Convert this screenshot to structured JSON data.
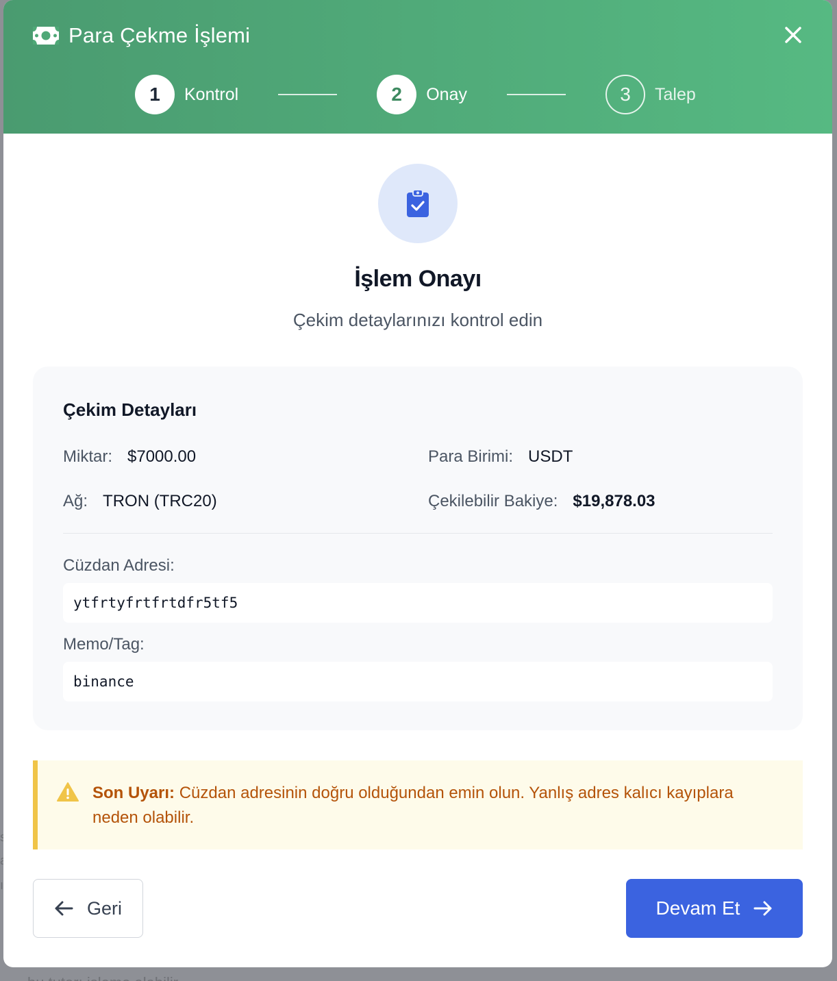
{
  "backdrop": {
    "fragment_bottom": "bu tutarı işleme alabilir..."
  },
  "header": {
    "title": "Para Çekme İşlemi",
    "icons": {
      "title": "money-bill-icon",
      "close": "close-icon"
    },
    "steps": [
      {
        "number": "1",
        "label": "Kontrol",
        "state": "done"
      },
      {
        "number": "2",
        "label": "Onay",
        "state": "active"
      },
      {
        "number": "3",
        "label": "Talep",
        "state": "pending"
      }
    ]
  },
  "hero": {
    "icon": "clipboard-check-icon",
    "title": "İşlem Onayı",
    "subtitle": "Çekim detaylarınızı kontrol edin"
  },
  "details": {
    "title": "Çekim Detayları",
    "amount": {
      "label": "Miktar:",
      "value": "$7000.00"
    },
    "currency": {
      "label": "Para Birimi:",
      "value": "USDT"
    },
    "network": {
      "label": "Ağ:",
      "value": "TRON (TRC20)"
    },
    "balance": {
      "label": "Çekilebilir Bakiye:",
      "value": "$19,878.03"
    },
    "wallet": {
      "label": "Cüzdan Adresi:",
      "value": "ytfrtyfrtfrtdfr5tf5"
    },
    "memo": {
      "label": "Memo/Tag:",
      "value": "binance"
    }
  },
  "warning": {
    "icon": "warning-triangle-icon",
    "title": "Son Uyarı:",
    "text": "Cüzdan adresinin doğru olduğundan emin olun. Yanlış adres kalıcı kayıplara neden olabilir."
  },
  "actions": {
    "back_label": "Geri",
    "next_label": "Devam Et"
  },
  "colors": {
    "header_start": "#4a9b70",
    "header_end": "#56b982",
    "primary": "#3b63e0",
    "warning_border": "#f0c448",
    "warning_text": "#b45309"
  }
}
